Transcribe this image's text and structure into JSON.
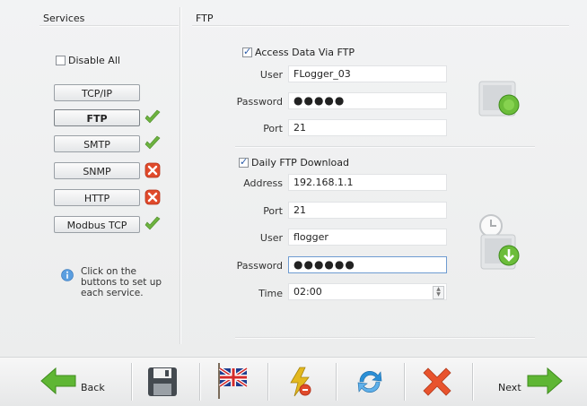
{
  "services_panel": {
    "title": "Services",
    "disable_all_label": "Disable All",
    "disable_all_checked": false,
    "buttons": [
      {
        "label": "TCP/IP",
        "status": "none"
      },
      {
        "label": "FTP",
        "status": "ok",
        "active": true
      },
      {
        "label": "SMTP",
        "status": "ok"
      },
      {
        "label": "SNMP",
        "status": "error"
      },
      {
        "label": "HTTP",
        "status": "error"
      },
      {
        "label": "Modbus TCP",
        "status": "ok"
      }
    ],
    "info_text": "Click on the buttons to set up each service."
  },
  "ftp_panel": {
    "title": "FTP",
    "access": {
      "checkbox_label": "Access Data Via FTP",
      "checked": true,
      "user_label": "User",
      "user_value": "FLogger_03",
      "password_label": "Password",
      "password_value": "●●●●●",
      "port_label": "Port",
      "port_value": "21"
    },
    "download": {
      "checkbox_label": "Daily FTP Download",
      "checked": true,
      "address_label": "Address",
      "address_value": "192.168.1.1",
      "port_label": "Port",
      "port_value": "21",
      "user_label": "User",
      "user_value": "flogger",
      "password_label": "Password",
      "password_value": "●●●●●●",
      "time_label": "Time",
      "time_value": "02:00"
    }
  },
  "toolbar": {
    "back_label": "Back",
    "next_label": "Next",
    "icons": [
      "back-arrow-icon",
      "save-icon",
      "language-flag-icon",
      "power-reset-icon",
      "refresh-icon",
      "cancel-icon",
      "next-arrow-icon"
    ]
  },
  "colors": {
    "ok_green": "#6db33f",
    "error_red": "#e04a2b",
    "arrow_green": "#5fb634",
    "cancel_red": "#e8532d",
    "refresh_blue": "#2b8fd6"
  }
}
